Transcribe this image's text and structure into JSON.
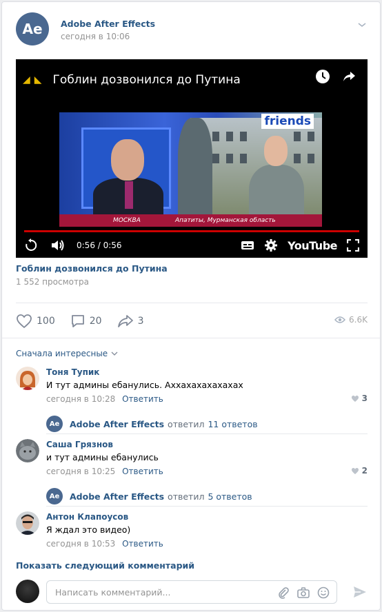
{
  "post": {
    "author": "Adobe After Effects",
    "avatar_text": "Ae",
    "time": "сегодня в 10:06"
  },
  "video": {
    "title": "Гоблин дозвонился до Путина",
    "time_display": "0:56 / 0:56",
    "progress": 1.0,
    "player_brand": "YouTube",
    "frame": {
      "channel_logo": "friends",
      "ticker_left": "МОСКВА",
      "ticker_right": "Апатиты, Мурманская область"
    }
  },
  "video_info": {
    "link_title": "Гоблин дозвонился до Путина",
    "views": "1 552 просмотра"
  },
  "actions": {
    "likes": "100",
    "comments": "20",
    "shares": "3",
    "views": "6.6K"
  },
  "comments_section": {
    "sort_label": "Сначала интересные",
    "items": [
      {
        "name": "Тоня Тупик",
        "text": "И тут админы ебанулись. Аххахахахахахах",
        "time": "сегодня в 10:28",
        "reply_label": "Ответить",
        "likes": "3",
        "thread": {
          "author": "Adobe After Effects",
          "verb": "ответил",
          "count": "11 ответов"
        }
      },
      {
        "name": "Саша Грязнов",
        "text": "и тут админы ебанулись",
        "time": "сегодня в 10:25",
        "reply_label": "Ответить",
        "likes": "2",
        "thread": {
          "author": "Adobe After Effects",
          "verb": "ответил",
          "count": "5 ответов"
        }
      },
      {
        "name": "Антон Клапоусов",
        "text": "Я ждал это видео)",
        "time": "сегодня в 10:53",
        "reply_label": "Ответить"
      }
    ],
    "show_next": "Показать следующий комментарий"
  },
  "composer": {
    "placeholder": "Написать комментарий..."
  },
  "colors": {
    "link": "#2a5885",
    "muted": "#939393",
    "progress": "#cc0000",
    "avatar_bg": "#4a6890"
  }
}
